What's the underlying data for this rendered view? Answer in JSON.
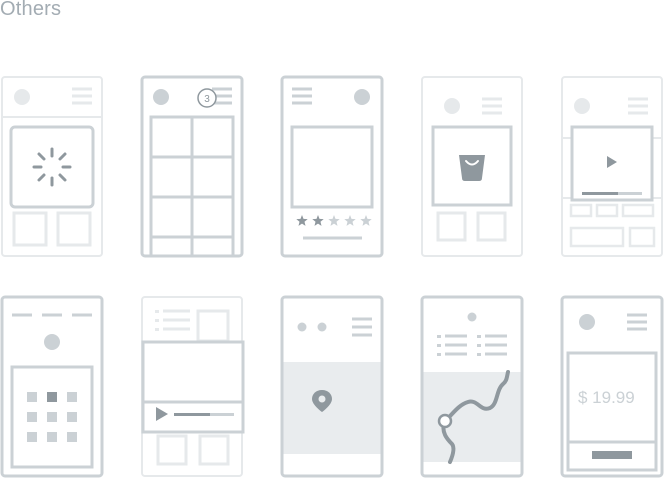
{
  "section": {
    "title": "Others"
  },
  "colors": {
    "dark": "#cbd1d5",
    "light": "#e6e9eb",
    "fill": "#f5f6f7",
    "icon": "#8f989e",
    "mapbg": "#e9ecee"
  },
  "cards": [
    {
      "name": "loading-screen",
      "icons": [
        "spinner-icon"
      ]
    },
    {
      "name": "grid-gallery",
      "badge": "3",
      "icons": [
        "notification-badge-icon",
        "menu-icon"
      ]
    },
    {
      "name": "rating-screen",
      "rating": {
        "filled": 2,
        "total": 5
      },
      "icons": [
        "star-icon",
        "menu-icon"
      ]
    },
    {
      "name": "shop-screen",
      "icons": [
        "shopping-bag-icon",
        "menu-icon"
      ]
    },
    {
      "name": "video-popup",
      "progress": 0.6,
      "icons": [
        "play-icon",
        "menu-icon"
      ]
    },
    {
      "name": "calendar-screen",
      "icons": [
        "calendar-grid-icon"
      ]
    },
    {
      "name": "video-player",
      "progress": 0.6,
      "icons": [
        "play-icon",
        "list-icon"
      ]
    },
    {
      "name": "location-map",
      "icons": [
        "location-pin-icon",
        "menu-icon"
      ]
    },
    {
      "name": "route-map",
      "icons": [
        "route-icon",
        "list-icon"
      ]
    },
    {
      "name": "payment-screen",
      "price": "$ 19.99",
      "icons": [
        "menu-icon"
      ]
    }
  ]
}
